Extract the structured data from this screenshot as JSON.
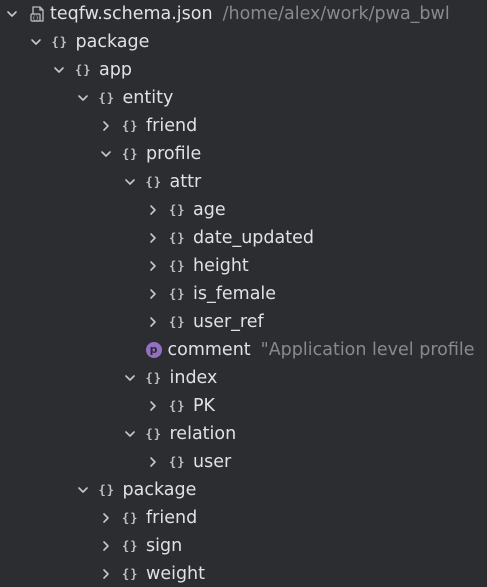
{
  "colors": {
    "background": "#2b2d30",
    "text": "#dfe1e5",
    "secondary_text": "#868a91",
    "property_badge": "#9470c4"
  },
  "tree": {
    "root": {
      "label": "teqfw.schema.json",
      "path": "/home/alex/work/pwa_bwl",
      "icon": "json-file-icon",
      "expanded": true
    },
    "nodes": [
      {
        "label": "package",
        "icon": "braces-icon",
        "expanded": true
      },
      {
        "label": "app",
        "icon": "braces-icon",
        "expanded": true
      },
      {
        "label": "entity",
        "icon": "braces-icon",
        "expanded": true
      },
      {
        "label": "friend",
        "icon": "braces-icon",
        "expanded": false
      },
      {
        "label": "profile",
        "icon": "braces-icon",
        "expanded": true
      },
      {
        "label": "attr",
        "icon": "braces-icon",
        "expanded": true
      },
      {
        "label": "age",
        "icon": "braces-icon",
        "expanded": false
      },
      {
        "label": "date_updated",
        "icon": "braces-icon",
        "expanded": false
      },
      {
        "label": "height",
        "icon": "braces-icon",
        "expanded": false
      },
      {
        "label": "is_female",
        "icon": "braces-icon",
        "expanded": false
      },
      {
        "label": "user_ref",
        "icon": "braces-icon",
        "expanded": false
      },
      {
        "label": "comment",
        "icon": "property-icon",
        "badge": "p",
        "value": "\"Application level profile"
      },
      {
        "label": "index",
        "icon": "braces-icon",
        "expanded": true
      },
      {
        "label": "PK",
        "icon": "braces-icon",
        "expanded": false
      },
      {
        "label": "relation",
        "icon": "braces-icon",
        "expanded": true
      },
      {
        "label": "user",
        "icon": "braces-icon",
        "expanded": false
      },
      {
        "label": "package",
        "icon": "braces-icon",
        "expanded": true
      },
      {
        "label": "friend",
        "icon": "braces-icon",
        "expanded": false
      },
      {
        "label": "sign",
        "icon": "braces-icon",
        "expanded": false
      },
      {
        "label": "weight",
        "icon": "braces-icon",
        "expanded": false
      }
    ],
    "braces_glyph": "{}"
  }
}
